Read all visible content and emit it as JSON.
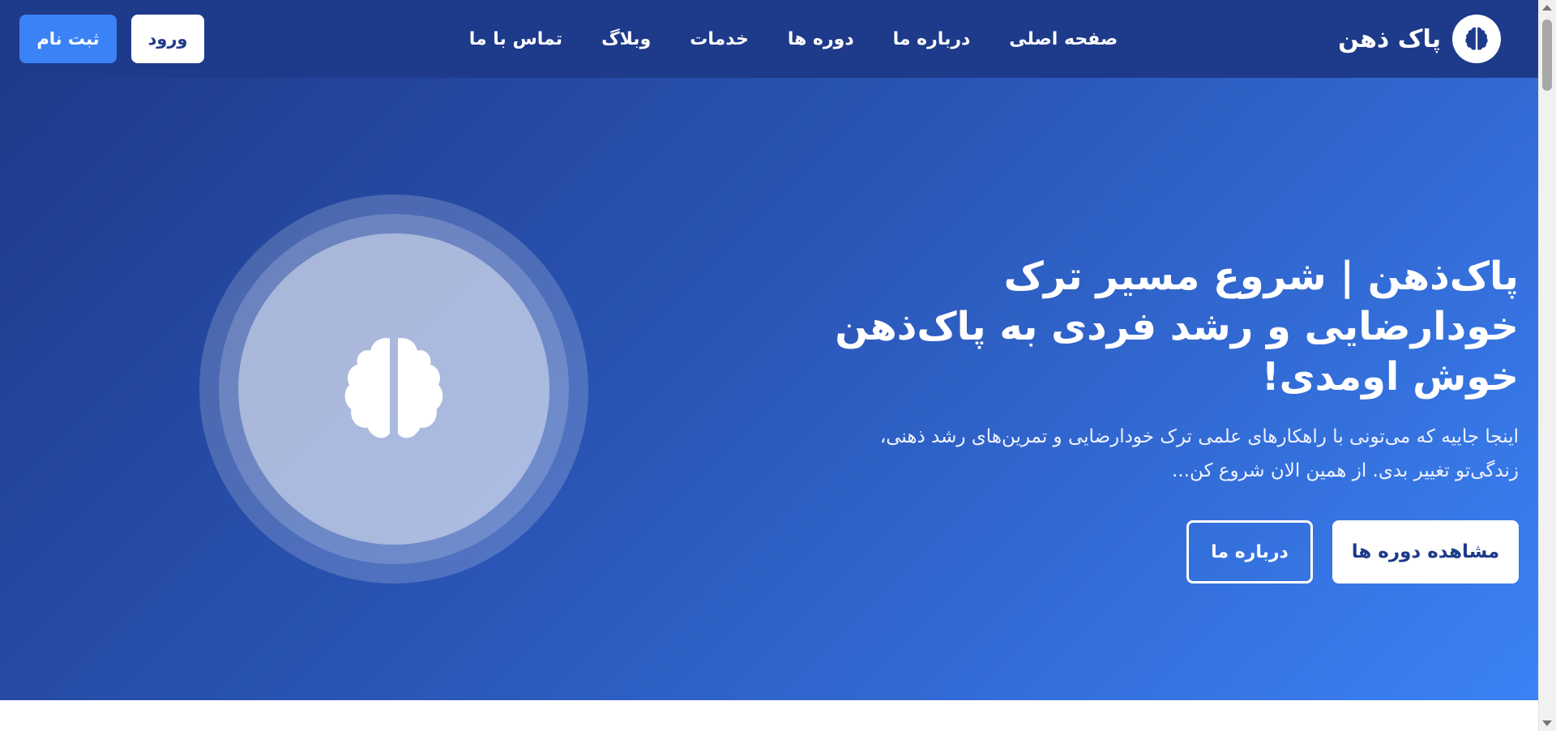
{
  "brand": {
    "name": "پاک ذهن",
    "logo_icon": "brain-icon"
  },
  "nav": {
    "items": [
      {
        "label": "صفحه اصلی"
      },
      {
        "label": "درباره ما"
      },
      {
        "label": "دوره ها"
      },
      {
        "label": "خدمات"
      },
      {
        "label": "وبلاگ"
      },
      {
        "label": "تماس با ما"
      }
    ]
  },
  "auth": {
    "login_label": "ورود",
    "register_label": "ثبت نام"
  },
  "hero": {
    "title": "پاک‌ذهن | شروع مسیر ترک خودارضایی و رشد فردی به پاک‌ذهن خوش اومدی!",
    "description": "اینجا جاییه که می‌تونی با راهکارهای علمی ترک خودارضایی و تمرین‌های رشد ذهنی، زندگی‌تو تغییر بدی. از همین الان شروع کن...",
    "primary_button": "مشاهده دوره ها",
    "secondary_button": "درباره ما",
    "illustration_icon": "brain-icon"
  },
  "colors": {
    "header_bg": "#1e3a8a",
    "accent": "#3b82f6",
    "hero_gradient_start": "#1e3a8a",
    "hero_gradient_end": "#3b82f6"
  }
}
